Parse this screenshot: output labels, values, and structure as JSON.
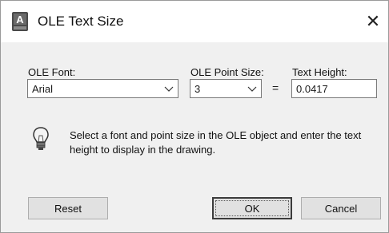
{
  "window": {
    "title": "OLE Text Size",
    "close_glyph": "✕",
    "app_icon_letter": "A"
  },
  "form": {
    "font_label": "OLE Font:",
    "font_value": "Arial",
    "point_size_label": "OLE Point Size:",
    "point_size_value": "3",
    "equals": "=",
    "text_height_label": "Text Height:",
    "text_height_value": "0.0417"
  },
  "info": {
    "message": "Select a font and point size in the OLE object and enter the text height to display in the drawing."
  },
  "buttons": {
    "reset": "Reset",
    "ok": "OK",
    "cancel": "Cancel"
  },
  "colors": {
    "dialog_bg": "#f0f0f0",
    "titlebar_bg": "#ffffff",
    "button_bg": "#e1e1e1"
  }
}
